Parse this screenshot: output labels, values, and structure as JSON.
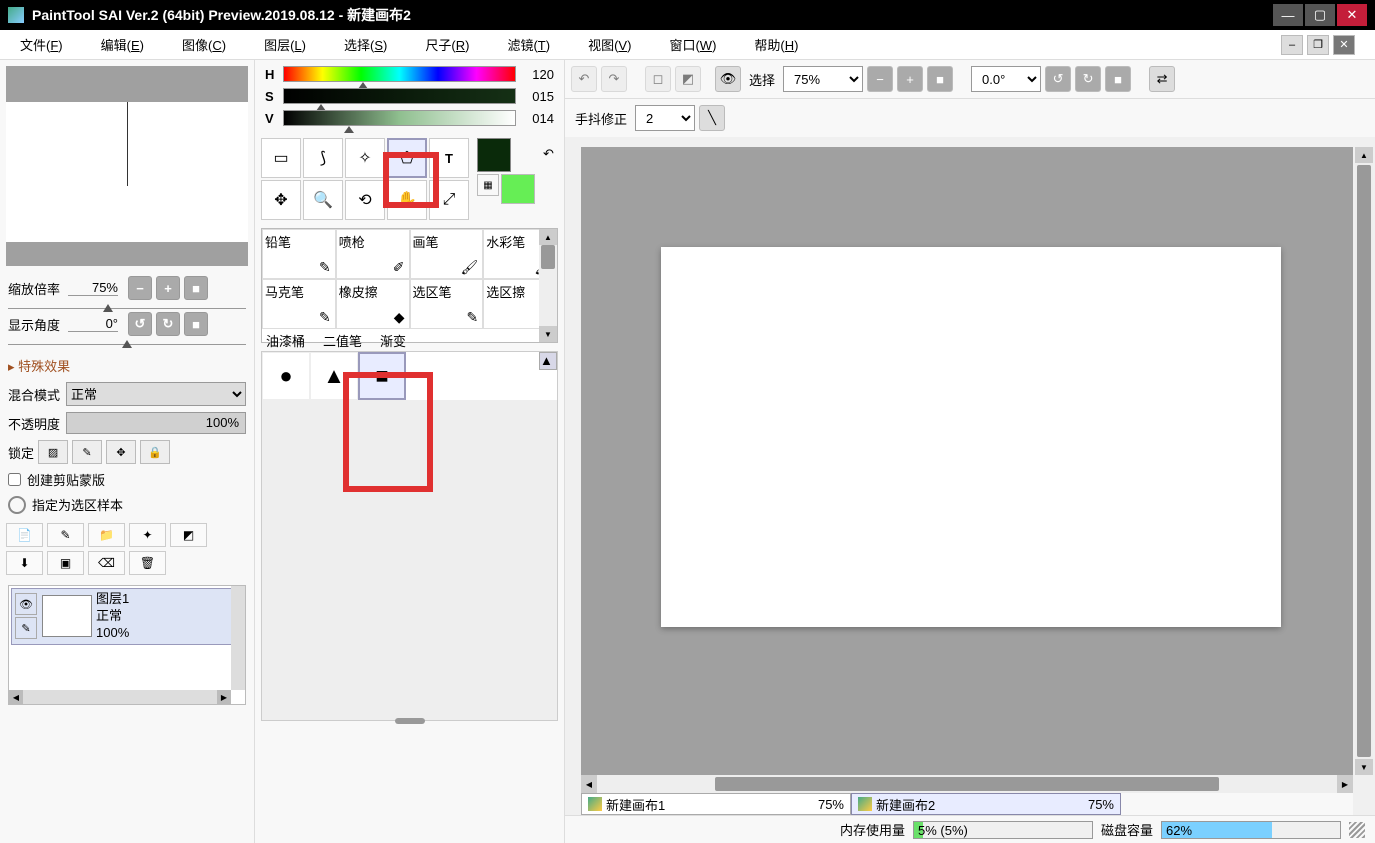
{
  "title": "PaintTool SAI Ver.2 (64bit) Preview.2019.08.12 - 新建画布2",
  "menu": [
    "文件(F)",
    "编辑(E)",
    "图像(C)",
    "图层(L)",
    "选择(S)",
    "尺子(R)",
    "滤镜(T)",
    "视图(V)",
    "窗口(W)",
    "帮助(H)"
  ],
  "nav": {
    "zoom_label": "缩放倍率",
    "zoom_value": "75%",
    "angle_label": "显示角度",
    "angle_value": "0°"
  },
  "special_fx": "特殊效果",
  "blend": {
    "label": "混合模式",
    "value": "正常"
  },
  "opacity": {
    "label": "不透明度",
    "value": "100%"
  },
  "lock_label": "锁定",
  "clip_label": "创建剪贴蒙版",
  "sel_src_label": "指定为选区样本",
  "layer": {
    "name": "图层1",
    "mode": "正常",
    "opacity": "100%"
  },
  "hsv": {
    "h": "120",
    "s": "015",
    "v": "014"
  },
  "colors": {
    "fg": "#0a2a0a",
    "bg": "#66ee55"
  },
  "brushes": [
    "铅笔",
    "喷枪",
    "画笔",
    "水彩笔",
    "马克笔",
    "橡皮擦",
    "选区笔",
    "选区擦",
    "油漆桶",
    "二值笔",
    "渐变",
    ""
  ],
  "toolbar": {
    "select_label": "选择",
    "zoom": "75%",
    "angle": "0.0°",
    "stab_label": "手抖修正",
    "stab_value": "2"
  },
  "tabs": [
    {
      "name": "新建画布1",
      "pct": "75%"
    },
    {
      "name": "新建画布2",
      "pct": "75%"
    }
  ],
  "status": {
    "mem_label": "内存使用量",
    "mem_text": "5% (5%)",
    "mem_fill": 5,
    "disk_label": "磁盘容量",
    "disk_text": "62%",
    "disk_fill": 62
  }
}
